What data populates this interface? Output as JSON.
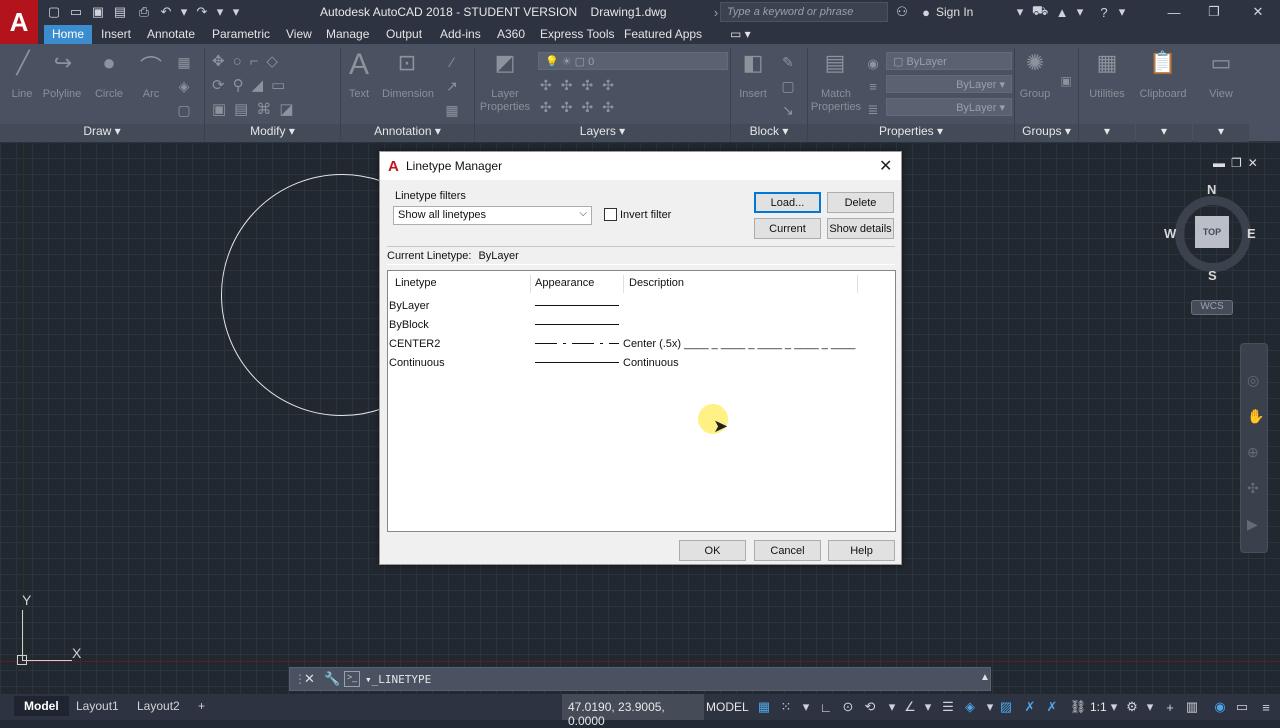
{
  "app": {
    "logo": "A",
    "title": "Autodesk AutoCAD 2018 - STUDENT VERSION    Drawing1.dwg",
    "search_placeholder": "Type a keyword or phrase",
    "sign_in": "Sign In"
  },
  "ribbon": {
    "tabs": [
      "Home",
      "Insert",
      "Annotate",
      "Parametric",
      "View",
      "Manage",
      "Output",
      "Add-ins",
      "A360",
      "Express Tools",
      "Featured Apps"
    ],
    "active_tab": "Home",
    "draw_tools": [
      "Line",
      "Polyline",
      "Circle",
      "Arc"
    ],
    "annotation_tools": [
      "Text",
      "Dimension"
    ],
    "layer_tool": "Layer Properties",
    "block_tool": "Insert",
    "match_tool": "Match Properties",
    "group_tool": "Group",
    "utilities": "Utilities",
    "clipboard": "Clipboard",
    "view": "View",
    "layer_combo": "0",
    "bylayer_color": "ByLayer",
    "bylayer_linetype": "ByLayer",
    "bylayer_lineweight": "ByLayer",
    "panels": [
      "Draw",
      "Modify",
      "Annotation",
      "Layers",
      "Block",
      "Properties",
      "Groups"
    ]
  },
  "viewcube": {
    "north": "N",
    "south": "S",
    "east": "E",
    "west": "W",
    "top": "TOP",
    "wcs": "WCS"
  },
  "ucs": {
    "x": "X",
    "y": "Y"
  },
  "dialog": {
    "logo": "A",
    "title": "Linetype Manager",
    "filters_label": "Linetype filters",
    "filter_value": "Show all linetypes",
    "invert_label": "Invert filter",
    "buttons": {
      "load": "Load...",
      "delete": "Delete",
      "current": "Current",
      "show_details": "Show details",
      "ok": "OK",
      "cancel": "Cancel",
      "help": "Help"
    },
    "current_label": "Current Linetype:",
    "current_value": "ByLayer",
    "columns": [
      "Linetype",
      "Appearance",
      "Description"
    ],
    "rows": [
      {
        "name": "ByLayer",
        "description": ""
      },
      {
        "name": "ByBlock",
        "description": ""
      },
      {
        "name": "CENTER2",
        "description": "Center (.5x) ____ _ ____ _ ____ _ ____ _ ____"
      },
      {
        "name": "Continuous",
        "description": "Continuous"
      }
    ]
  },
  "command": {
    "text": "_LINETYPE"
  },
  "status": {
    "layouts": [
      "Model",
      "Layout1",
      "Layout2"
    ],
    "add": "+",
    "coords": "47.0190, 23.9005, 0.0000",
    "model": "MODEL",
    "scale": "1:1"
  },
  "colors": {
    "accent": "#3c8dd0",
    "app_red": "#b3141b",
    "canvas": "#212830",
    "ribbon": "#4a5160"
  }
}
